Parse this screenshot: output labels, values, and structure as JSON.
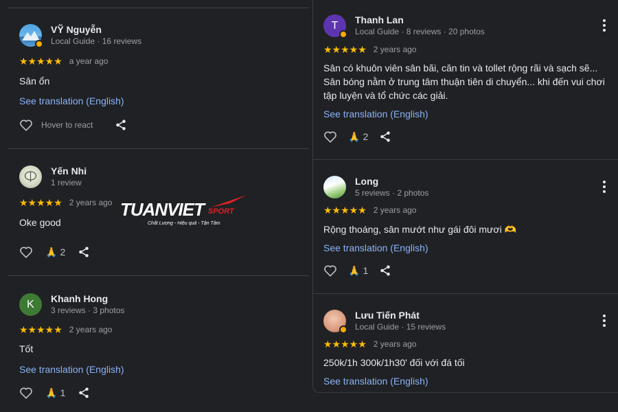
{
  "colors": {
    "background": "#202124",
    "star": "#fbbc04",
    "link": "#8ab4f8",
    "muted": "#9aa0a6"
  },
  "left_reviews": [
    {
      "name": "VỸ Nguyễn",
      "meta": "Local Guide · 16 reviews",
      "stars": "★★★★★",
      "date": "a year ago",
      "text": "Sân ổn",
      "translation": "See translation (English)",
      "hover": "Hover to react"
    },
    {
      "name": "Yến Nhi",
      "meta": "1 review",
      "stars": "★★★★★",
      "date": "2 years ago",
      "text": "Oke good",
      "reactions": "2"
    },
    {
      "name": "Khanh Hong",
      "avatar_letter": "K",
      "meta": "3 reviews · 3 photos",
      "stars": "★★★★★",
      "date": "2 years ago",
      "text": "Tốt",
      "translation": "See translation (English)",
      "reactions": "1"
    }
  ],
  "right_reviews": [
    {
      "name": "Thanh Lan",
      "avatar_letter": "T",
      "meta": "Local Guide · 8 reviews · 20 photos",
      "stars": "★★★★★",
      "date": "2 years ago",
      "text": "Sân có khuôn viên sân bãi, căn tin và tollet rộng rãi và sạch sẽ... Sân bóng nằm ở trung tâm thuận tiên di chuyển... khi đến vui chơi tập luyện và tổ chức các giải.",
      "translation": "See translation (English)",
      "reactions": "2"
    },
    {
      "name": "Long",
      "meta": "5 reviews · 2 photos",
      "stars": "★★★★★",
      "date": "2 years ago",
      "text": "Rộng thoáng, sân mướt như gái đôi mươi 🫶",
      "translation": "See translation (English)",
      "reactions": "1"
    },
    {
      "name": "Lưu Tiến Phát",
      "meta": "Local Guide · 15 reviews",
      "stars": "★★★★★",
      "date": "2 years ago",
      "text": "250k/1h 300k/1h30' đối với đá tối",
      "translation": "See translation (English)"
    }
  ],
  "watermark": {
    "brand": "TUANVIET",
    "sub": "SPORT",
    "tagline": "Chất Lượng - Hiệu quả - Tận Tâm"
  },
  "icons": {
    "reaction": "🙏",
    "heart": "heart-icon",
    "share": "share-icon",
    "more": "more-vert-icon"
  }
}
